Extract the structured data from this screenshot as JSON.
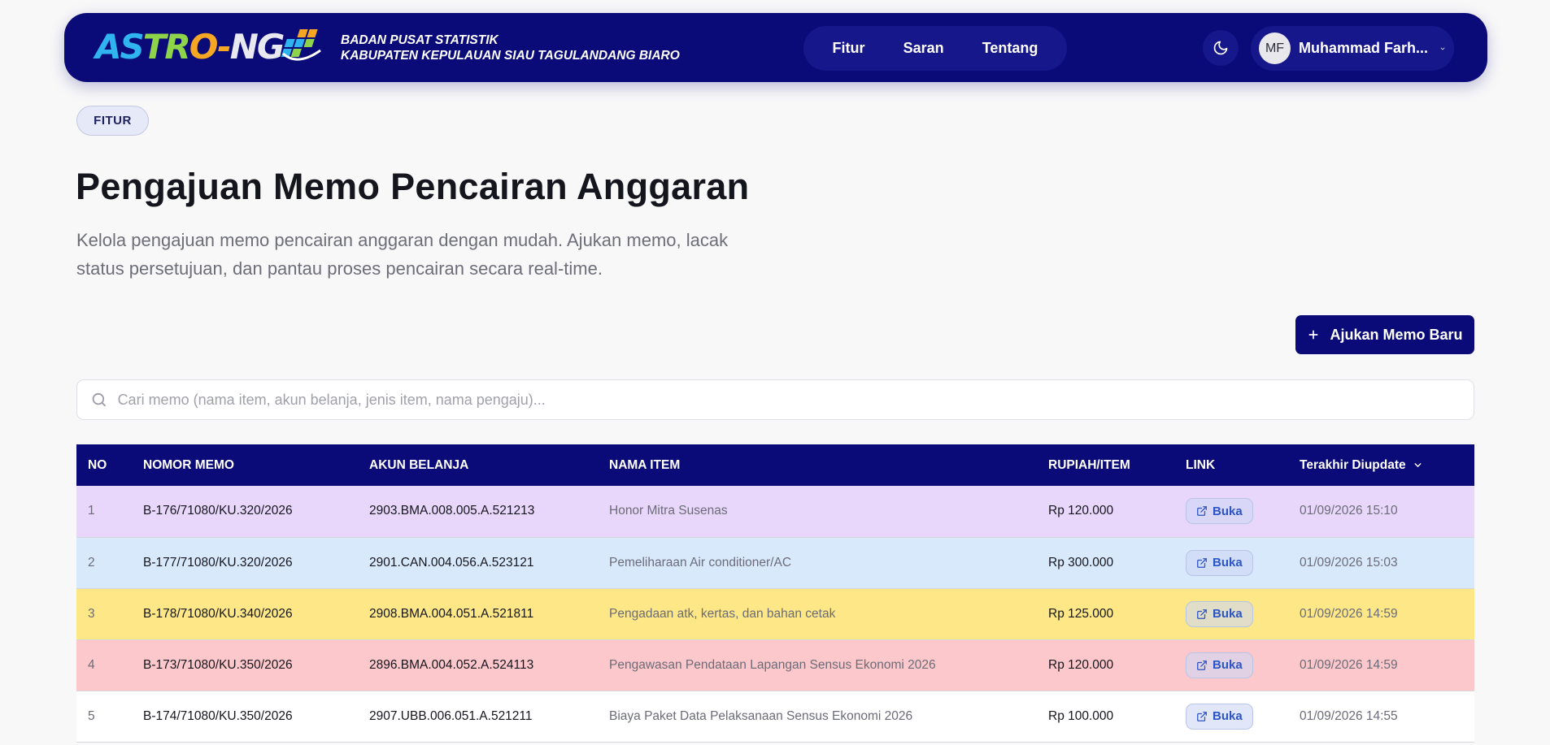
{
  "header": {
    "logo_text": "ASTRO-NG",
    "org_line1": "BADAN PUSAT STATISTIK",
    "org_line2": "KABUPATEN KEPULAUAN SIAU TAGULANDANG BIARO",
    "nav": [
      {
        "label": "Fitur"
      },
      {
        "label": "Saran"
      },
      {
        "label": "Tentang"
      }
    ],
    "theme_icon": "moon-icon",
    "user": {
      "initials": "MF",
      "name": "Muhammad Farh..."
    }
  },
  "page": {
    "badge": "FITUR",
    "title": "Pengajuan Memo Pencairan Anggaran",
    "description": "Kelola pengajuan memo pencairan anggaran dengan mudah. Ajukan memo, lacak status persetujuan, dan pantau proses pencairan secara real-time.",
    "new_button": "Ajukan Memo Baru"
  },
  "search": {
    "placeholder": "Cari memo (nama item, akun belanja, jenis item, nama pengaju)..."
  },
  "table": {
    "columns": {
      "no": "NO",
      "nomor": "NOMOR MEMO",
      "akun": "AKUN BELANJA",
      "item": "NAMA ITEM",
      "rupiah": "RUPIAH/ITEM",
      "link": "LINK",
      "updated": "Terakhir Diupdate"
    },
    "link_label": "Buka",
    "rows": [
      {
        "no": "1",
        "nomor": "B-176/71080/KU.320/2026",
        "akun": "2903.BMA.008.005.A.521213",
        "item": "Honor Mitra Susenas",
        "rupiah": "Rp 120.000",
        "updated": "01/09/2026 15:10",
        "color": "#e8d6fb"
      },
      {
        "no": "2",
        "nomor": "B-177/71080/KU.320/2026",
        "akun": "2901.CAN.004.056.A.523121",
        "item": "Pemeliharaan Air conditioner/AC",
        "rupiah": "Rp 300.000",
        "updated": "01/09/2026 15:03",
        "color": "#d9e9fc"
      },
      {
        "no": "3",
        "nomor": "B-178/71080/KU.340/2026",
        "akun": "2908.BMA.004.051.A.521811",
        "item": "Pengadaan atk, kertas, dan bahan cetak",
        "rupiah": "Rp 125.000",
        "updated": "01/09/2026 14:59",
        "color": "#fde787"
      },
      {
        "no": "4",
        "nomor": "B-173/71080/KU.350/2026",
        "akun": "2896.BMA.004.052.A.524113",
        "item": "Pengawasan Pendataan Lapangan Sensus Ekonomi 2026",
        "rupiah": "Rp 120.000",
        "updated": "01/09/2026 14:59",
        "color": "#fdc8cb"
      },
      {
        "no": "5",
        "nomor": "B-174/71080/KU.350/2026",
        "akun": "2907.UBB.006.051.A.521211",
        "item": "Biaya Paket Data Pelaksanaan Sensus Ekonomi 2026",
        "rupiah": "Rp 100.000",
        "updated": "01/09/2026 14:55",
        "color": "#ffffff"
      }
    ]
  }
}
